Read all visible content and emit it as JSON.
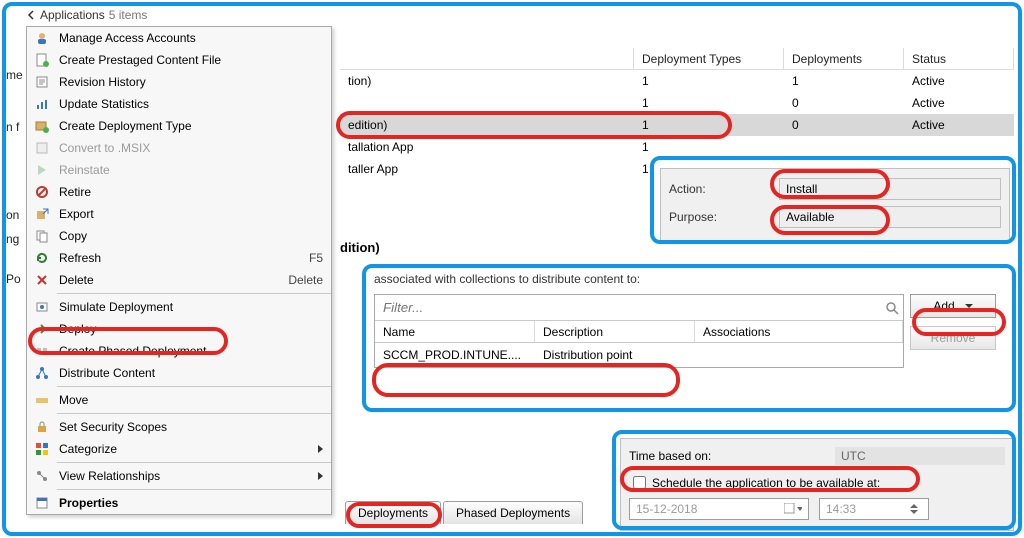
{
  "breadcrumb": {
    "title": "Applications",
    "count_suffix": "5 items"
  },
  "left_fragments": {
    "f1": "me",
    "f2": "n f",
    "f3": "on",
    "f4": "ng",
    "f5": "Po"
  },
  "contextMenu": {
    "items": [
      {
        "label": "Manage Access Accounts"
      },
      {
        "label": "Create Prestaged Content File"
      },
      {
        "label": "Revision History"
      },
      {
        "label": "Update Statistics"
      },
      {
        "label": "Create Deployment Type"
      },
      {
        "label": "Convert to .MSIX",
        "disabled": true
      },
      {
        "label": "Reinstate",
        "disabled": true
      },
      {
        "label": "Retire"
      },
      {
        "label": "Export"
      },
      {
        "label": "Copy"
      },
      {
        "label": "Refresh",
        "shortcut": "F5"
      },
      {
        "label": "Delete",
        "shortcut": "Delete"
      },
      {
        "label": "Simulate Deployment"
      },
      {
        "label": "Deploy"
      },
      {
        "label": "Create Phased Deployment"
      },
      {
        "label": "Distribute Content"
      },
      {
        "label": "Move"
      },
      {
        "label": "Set Security Scopes"
      },
      {
        "label": "Categorize",
        "submenu": true
      },
      {
        "label": "View Relationships",
        "submenu": true
      },
      {
        "label": "Properties",
        "bold": true
      }
    ]
  },
  "grid": {
    "columns": {
      "deptypes": "Deployment Types",
      "deployments": "Deployments",
      "status": "Status"
    },
    "rows": [
      {
        "name": "tion)",
        "dt": "1",
        "dep": "1",
        "status": "Active"
      },
      {
        "name": "",
        "dt": "1",
        "dep": "0",
        "status": "Active"
      },
      {
        "name": "  edition)",
        "dt": "1",
        "dep": "0",
        "status": "Active",
        "selected": true
      },
      {
        "name": "tallation App",
        "dt": "1",
        "dep": "",
        "status": ""
      },
      {
        "name": "taller App",
        "dt": "1",
        "dep": "",
        "status": ""
      }
    ],
    "section_title": "dition)"
  },
  "actionPanel": {
    "action_label": "Action:",
    "action_value": "Install",
    "purpose_label": "Purpose:",
    "purpose_value": "Available"
  },
  "distribute": {
    "caption": "associated with collections to distribute content to:",
    "filter_placeholder": "Filter...",
    "columns": {
      "name": "Name",
      "desc": "Description",
      "assoc": "Associations"
    },
    "rows": [
      {
        "name": "SCCM_PROD.INTUNE....",
        "desc": "Distribution point",
        "assoc": ""
      }
    ],
    "add": "Add",
    "remove": "Remove"
  },
  "tabs": {
    "t1": "Deployments",
    "t2": "Phased Deployments"
  },
  "schedule": {
    "time_based_label": "Time based on:",
    "time_based_value": "UTC",
    "checkbox_label": "Schedule the application to be available at:",
    "date": "15-12-2018",
    "time": "14:33"
  }
}
